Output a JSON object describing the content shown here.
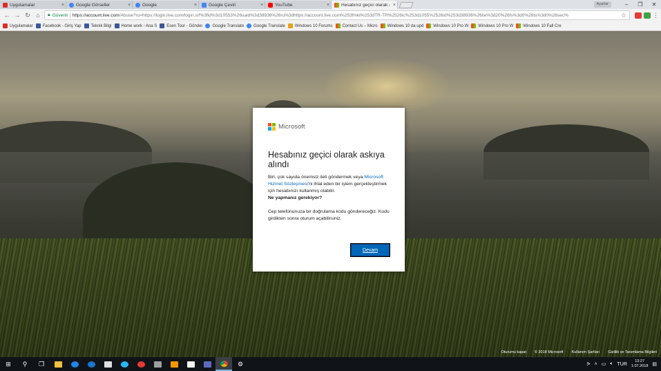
{
  "browser": {
    "tabs": [
      {
        "title": "Uygulamalar",
        "favicon_color": "#d93025",
        "active": false
      },
      {
        "title": "Google Görseller",
        "favicon_color": "#4285f4",
        "active": false
      },
      {
        "title": "Google",
        "favicon_color": "#4285f4",
        "active": false
      },
      {
        "title": "Google Çeviri",
        "favicon_color": "#4285f4",
        "active": false
      },
      {
        "title": "YouTube",
        "favicon_color": "#ff0000",
        "active": false
      },
      {
        "title": "Hesabınız geçici olarak a",
        "favicon_color": "#f25022",
        "active": true
      }
    ],
    "close_glyph": "×",
    "profile": "Ayarlar",
    "window_controls": {
      "minimize": "–",
      "maximize": "❐",
      "close": "✕"
    },
    "security_label": "Güvenli",
    "url_domain": "https://account.live.com",
    "url_rest": "/Abuse?ru=https://login.live.com/login.srf%3fid%3d10553%26uaid%3d38936%26ru%3dhttps://account.live.com%253fmkt%253dTR-TR%2526ic%253d1055%2526id%253d38936%26tw%3d20%26fs%3d0%26ts%3d0%26sec%"
  },
  "bookmarks": [
    {
      "label": "Uygulamalar",
      "color": "#d93025"
    },
    {
      "label": "Facebook - Giriş Yap",
      "color": "#3b5998"
    },
    {
      "label": "Teknik Bilgi",
      "color": "#3b5998"
    },
    {
      "label": "Home work - Ana S",
      "color": "#3b5998"
    },
    {
      "label": "Esen Tour - Gönder",
      "color": "#3b5998"
    },
    {
      "label": "Google Translate",
      "color": "#4285f4"
    },
    {
      "label": "Google Translate",
      "color": "#4285f4"
    },
    {
      "label": "Windows 10 Forums",
      "color": "#e8a317"
    },
    {
      "label": "Contact Us – Micro",
      "color": "#f25022"
    },
    {
      "label": "Windows 10 da upd",
      "color": "#f25022"
    },
    {
      "label": "Windows 10 Pro W",
      "color": "#f25022"
    },
    {
      "label": "Windows 10 Pro W",
      "color": "#f25022"
    },
    {
      "label": "Windows 10 Fall Cre",
      "color": "#f25022"
    }
  ],
  "dialog": {
    "brand": "Microsoft",
    "title": "Hesabınız geçici olarak askıya alındı",
    "para1_a": "Biri, çok sayıda önemsiz ileti göndermek veya ",
    "para1_link": "Microsoft Hizmet Sözleşmesi",
    "para1_b": "'ni ihlal eden bir işlem gerçekleştirmek için hesabınızı kullanmış olabilir.",
    "question": "Ne yapmanız gerekiyor?",
    "para2": "Cep telefonunuza bir doğrulama kodu göndereceğiz.  Kodu girdikten sonra oturum açabilirsiniz.",
    "button": "Devam"
  },
  "footer": [
    "Oturumu kapat",
    "© 2018 Microsoft",
    "Kullanım Şartları",
    "Gizlilik ve Tanımlama Bilgileri"
  ],
  "taskbar": {
    "time": "13:27",
    "date": "1.07.2018",
    "language": "TUR"
  }
}
